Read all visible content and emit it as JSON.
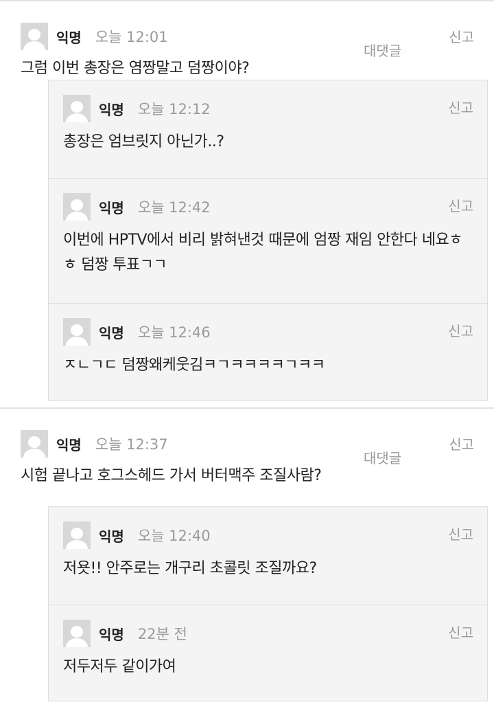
{
  "threads": [
    {
      "author": "익명",
      "time": "오늘 12:01",
      "reply_label": "대댓글",
      "report_label": "신고",
      "text": "그럼 이번 총장은 염짱말고 덤짱이야?",
      "replies": [
        {
          "author": "익명",
          "time": "오늘 12:12",
          "report_label": "신고",
          "text": "총장은 엄브릿지 아닌가..?"
        },
        {
          "author": "익명",
          "time": "오늘 12:42",
          "report_label": "신고",
          "text": "이번에 HPTV에서 비리 밝혀낸것 때문에 엄짱 재임 안한다 네요ㅎㅎ 덤짱 투표ㄱㄱ"
        },
        {
          "author": "익명",
          "time": "오늘 12:46",
          "report_label": "신고",
          "text": "ㅈㄴㄱㄷ 덤짱왜케웃김ㅋㄱㅋㅋㅋㅋㄱㅋㅋ"
        }
      ]
    },
    {
      "author": "익명",
      "time": "오늘 12:37",
      "reply_label": "대댓글",
      "report_label": "신고",
      "text": "시험 끝나고 호그스헤드 가서 버터맥주 조질사람?",
      "replies": [
        {
          "author": "익명",
          "time": "오늘 12:40",
          "report_label": "신고",
          "text": "저욧!! 안주로는 개구리 초콜릿 조질까요?"
        },
        {
          "author": "익명",
          "time": "22분 전",
          "report_label": "신고",
          "text": "저두저두 같이가여"
        }
      ]
    }
  ]
}
